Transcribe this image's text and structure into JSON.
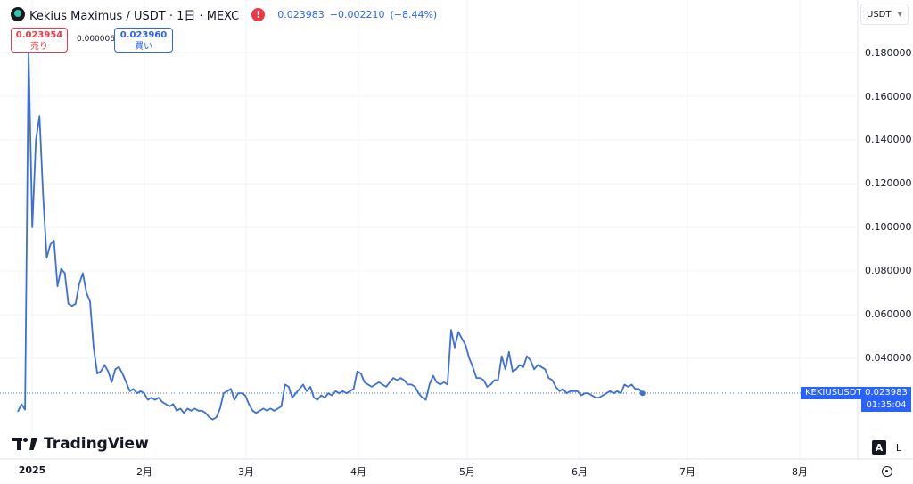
{
  "header": {
    "symbol_title": "Kekius Maximus / USDT · 1日 · MEXC",
    "alert_icon": "!",
    "price": "0.023983",
    "change": "−0.002210",
    "change_pct": "(−8.44%)"
  },
  "trade": {
    "sell_price": "0.023954",
    "sell_label": "売り",
    "spread": "0.000006",
    "buy_price": "0.023960",
    "buy_label": "買い"
  },
  "currency_select": {
    "value": "USDT"
  },
  "price_scale": {
    "ticks": [
      "0.180000",
      "0.160000",
      "0.140000",
      "0.120000",
      "0.100000",
      "0.080000",
      "0.060000",
      "0.040000"
    ]
  },
  "time_scale": {
    "ticks": [
      "2025",
      "2月",
      "3月",
      "4月",
      "5月",
      "6月",
      "7月",
      "8月"
    ]
  },
  "last_price": {
    "symbol": "KEKIUSUSDT",
    "value": "0.023983",
    "countdown": "01:35:04"
  },
  "branding": {
    "name": "TradingView"
  },
  "scale_buttons": {
    "auto": "A",
    "log": "L"
  },
  "colors": {
    "line": "#3b6fdc",
    "accent": "#2962ff",
    "sell": "#f23645",
    "grid": "#f0f3fa"
  },
  "chart_data": {
    "type": "line",
    "series": [
      {
        "start": "2024-12-27",
        "interval": "1d",
        "values": [
          0.0155,
          0.019,
          0.0165,
          0.18,
          0.1,
          0.14,
          0.151,
          0.115,
          0.086,
          0.092,
          0.094,
          0.073,
          0.081,
          0.079,
          0.065,
          0.064,
          0.065,
          0.074,
          0.079,
          0.07,
          0.066,
          0.045,
          0.033,
          0.034,
          0.037,
          0.034,
          0.029,
          0.035,
          0.036,
          0.033,
          0.029,
          0.025,
          0.026,
          0.024,
          0.025,
          0.024,
          0.021,
          0.022,
          0.021,
          0.022,
          0.02,
          0.019,
          0.018,
          0.019,
          0.016,
          0.017,
          0.015,
          0.017,
          0.016,
          0.017,
          0.016,
          0.016,
          0.015,
          0.013,
          0.012,
          0.013,
          0.017,
          0.024,
          0.025,
          0.026,
          0.021,
          0.024,
          0.024,
          0.023,
          0.019,
          0.016,
          0.015,
          0.016,
          0.017,
          0.016,
          0.017,
          0.016,
          0.017,
          0.018,
          0.028,
          0.027,
          0.022,
          0.024,
          0.026,
          0.028,
          0.025,
          0.027,
          0.022,
          0.021,
          0.023,
          0.022,
          0.024,
          0.023,
          0.025,
          0.024,
          0.025,
          0.024,
          0.025,
          0.026,
          0.034,
          0.033,
          0.029,
          0.028,
          0.027,
          0.028,
          0.029,
          0.028,
          0.027,
          0.029,
          0.031,
          0.03,
          0.031,
          0.03,
          0.028,
          0.028,
          0.027,
          0.024,
          0.022,
          0.021,
          0.028,
          0.032,
          0.029,
          0.028,
          0.029,
          0.028,
          0.053,
          0.045,
          0.052,
          0.049,
          0.046,
          0.04,
          0.036,
          0.031,
          0.031,
          0.03,
          0.027,
          0.028,
          0.03,
          0.03,
          0.041,
          0.035,
          0.043,
          0.034,
          0.035,
          0.037,
          0.036,
          0.041,
          0.039,
          0.035,
          0.037,
          0.036,
          0.035,
          0.031,
          0.03,
          0.027,
          0.025,
          0.026,
          0.024,
          0.025,
          0.025,
          0.025,
          0.023,
          0.024,
          0.024,
          0.023,
          0.022,
          0.022,
          0.023,
          0.024,
          0.025,
          0.024,
          0.025,
          0.024,
          0.028,
          0.027,
          0.028,
          0.026,
          0.026,
          0.024
        ]
      }
    ],
    "xlabel": "",
    "ylabel": "",
    "ylim": [
      0.0,
      0.19
    ],
    "x_tick_labels": [
      "2025",
      "2月",
      "3月",
      "4月",
      "5月",
      "6月",
      "7月",
      "8月"
    ],
    "y_tick_labels": [
      "0.180000",
      "0.160000",
      "0.140000",
      "0.120000",
      "0.100000",
      "0.080000",
      "0.060000",
      "0.040000"
    ],
    "grid": true,
    "legend": "none"
  }
}
